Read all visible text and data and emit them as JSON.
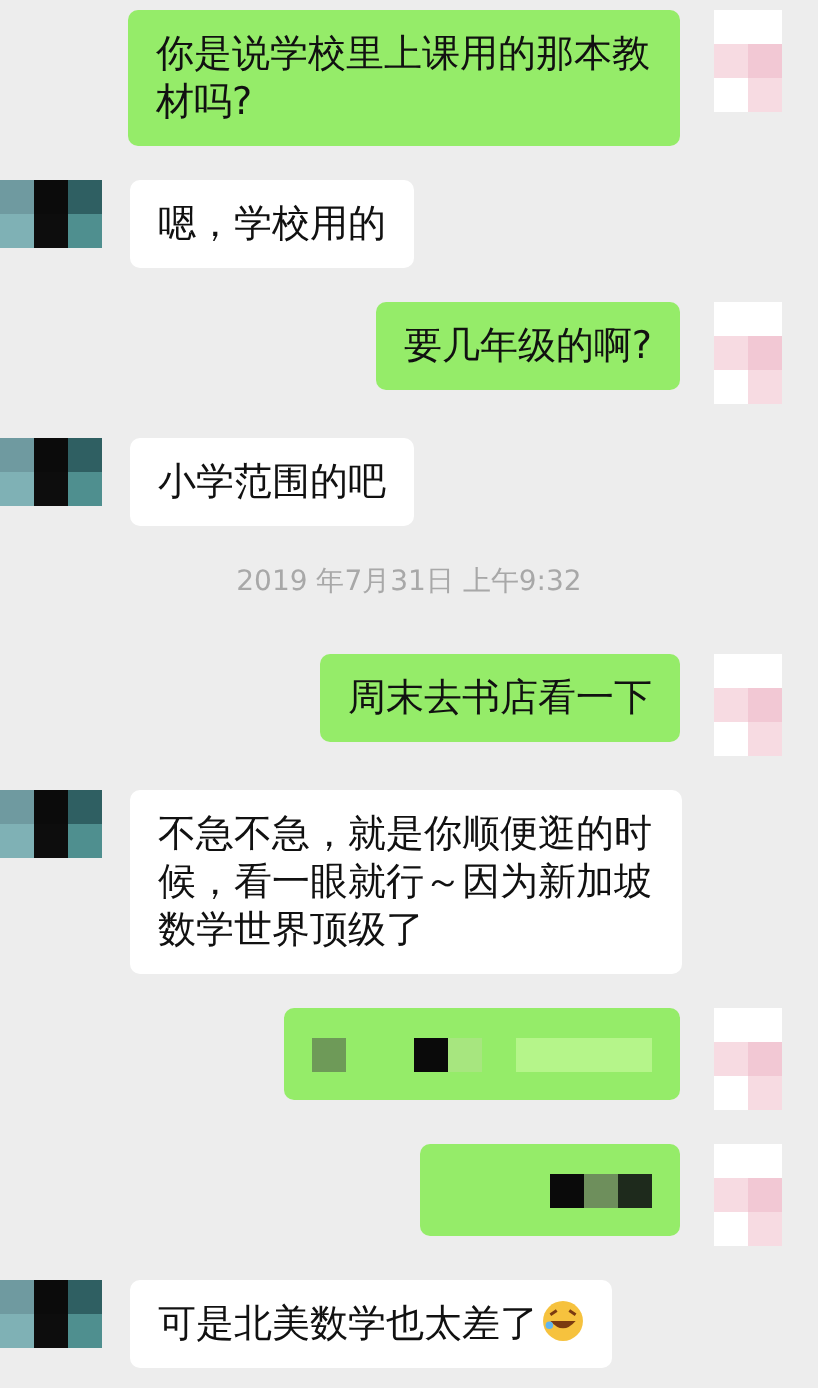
{
  "messages": [
    {
      "kind": "outgoing",
      "text": "你是说学校里上课用的那本教材吗?"
    },
    {
      "kind": "incoming",
      "text": "嗯，学校用的"
    },
    {
      "kind": "outgoing",
      "text": "要几年级的啊?"
    },
    {
      "kind": "incoming",
      "text": "小学范围的吧"
    },
    {
      "kind": "time",
      "text": "2019 年7月31日 上午9:32"
    },
    {
      "kind": "outgoing",
      "text": "周末去书店看一下"
    },
    {
      "kind": "incoming",
      "text": "不急不急，就是你顺便逛的时候，看一眼就行～因为新加坡数学世界顶级了"
    },
    {
      "kind": "outgoing_blurred"
    },
    {
      "kind": "outgoing_blurred"
    },
    {
      "kind": "incoming",
      "text": "可是北美数学也太差了",
      "emoji": true
    }
  ]
}
